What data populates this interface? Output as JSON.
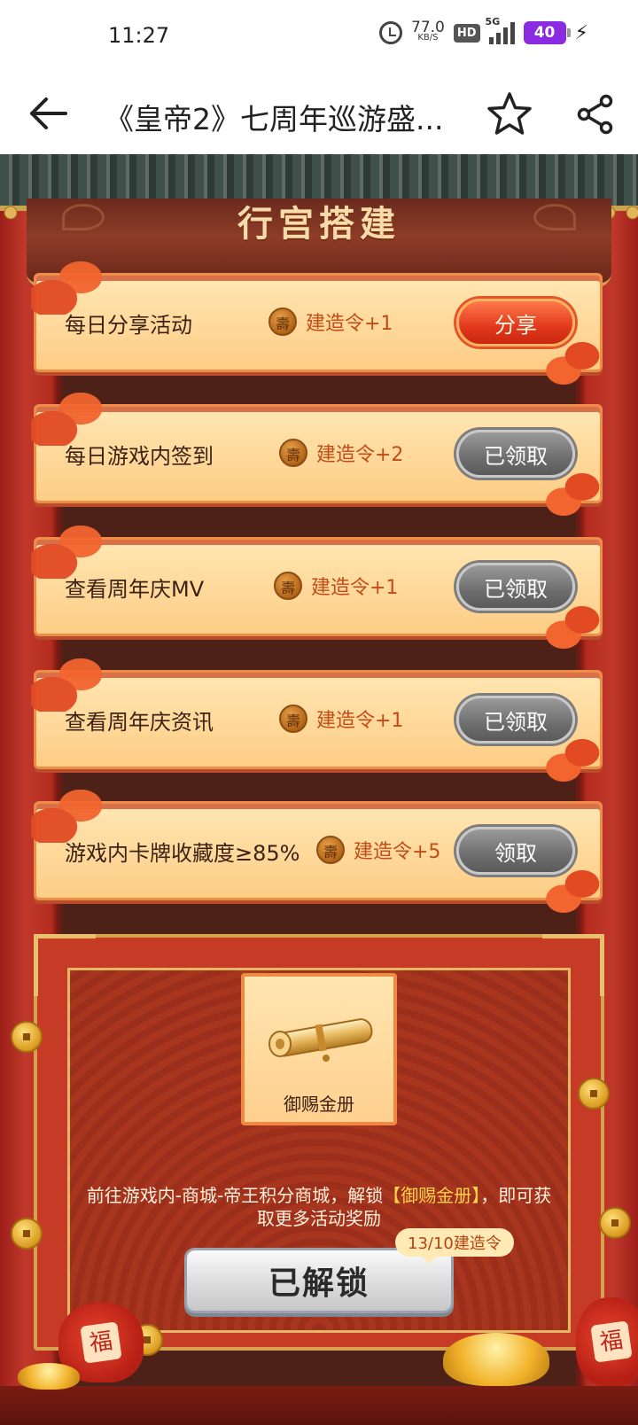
{
  "status_bar": {
    "time": "11:27",
    "net_speed_value": "77.0",
    "net_speed_unit": "KB/S",
    "hd_label": "HD",
    "network_label": "5G",
    "battery_level": "40",
    "icons": [
      "alarm-icon",
      "hd-icon",
      "signal-icon",
      "battery-icon",
      "charging-icon"
    ]
  },
  "header": {
    "title": "《皇帝2》七周年巡游盛...",
    "icons": [
      "back-arrow-icon",
      "star-icon",
      "share-icon"
    ]
  },
  "section": {
    "title": "行宫搭建"
  },
  "tasks": [
    {
      "name": "每日分享活动",
      "reward": "建造令+1",
      "button": "分享",
      "state": "active"
    },
    {
      "name": "每日游戏内签到",
      "reward": "建造令+2",
      "button": "已领取",
      "state": "done"
    },
    {
      "name": "查看周年庆MV",
      "reward": "建造令+1",
      "button": "已领取",
      "state": "done"
    },
    {
      "name": "查看周年庆资讯",
      "reward": "建造令+1",
      "button": "已领取",
      "state": "done"
    },
    {
      "name": "游戏内卡牌收藏度≥85%",
      "reward": "建造令+5",
      "button": "领取",
      "state": "done"
    }
  ],
  "unlock": {
    "item_name": "御赐金册",
    "desc_prefix": "前往游戏内-商城-帝王积分商城，解锁",
    "desc_highlight": "【御赐金册】",
    "desc_suffix": "，即可获取更多活动奖励",
    "progress": "13/10建造令",
    "button": "已解锁"
  },
  "colors": {
    "accent_red": "#e2391d",
    "card_bg": "#ffd89a",
    "panel_red": "#c53b25",
    "gold": "#d7a24e",
    "highlight_yellow": "#ffd24a"
  }
}
